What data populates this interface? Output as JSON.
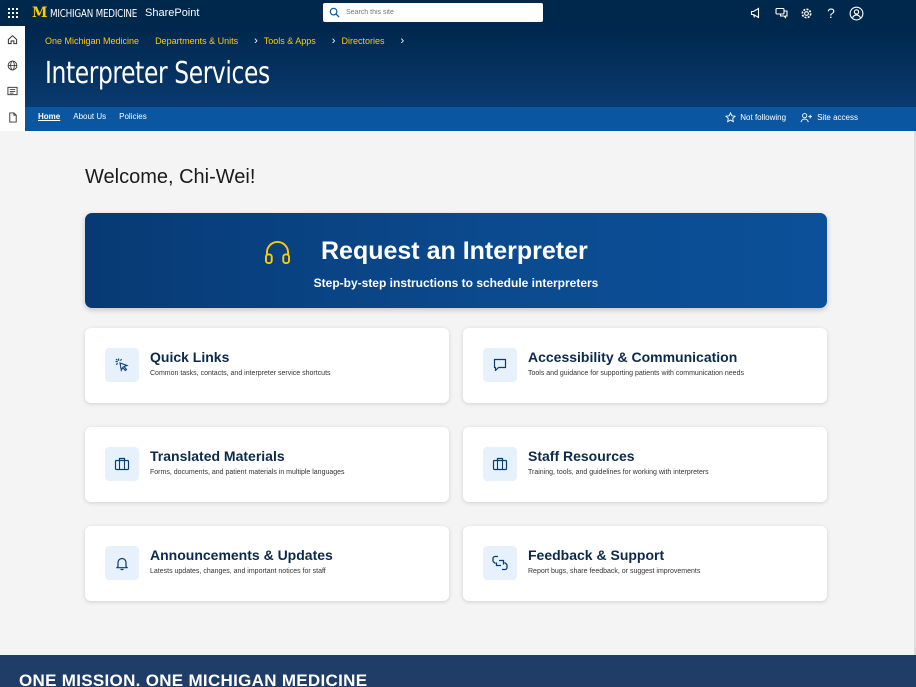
{
  "suite": {
    "logo_mark": "M",
    "logo_text": "MICHIGAN MEDICINE",
    "app_name": "SharePoint",
    "search_placeholder": "Search this site",
    "icons": [
      "megaphone-icon",
      "chat-icon",
      "gear-icon",
      "help-icon",
      "account-icon"
    ],
    "help_glyph": "?"
  },
  "rail": {
    "icons": [
      "home-icon",
      "globe-icon",
      "news-icon",
      "file-icon"
    ]
  },
  "header": {
    "breadcrumb": [
      "One Michigan Medicine",
      "Departments & Units",
      "Tools & Apps",
      "Directories"
    ],
    "title": "Interpreter Services"
  },
  "nav": {
    "links": [
      "Home",
      "About Us",
      "Policies"
    ],
    "follow_label": "Not following",
    "access_label": "Site access"
  },
  "main": {
    "welcome": "Welcome, Chi-Wei!",
    "hero": {
      "title": "Request an Interpreter",
      "subtitle": "Step-by-step instructions to schedule interpreters"
    },
    "cards": [
      {
        "title": "Quick Links",
        "desc": "Common tasks, contacts, and interpreter service shortcuts",
        "icon": "cursor-click-icon"
      },
      {
        "title": "Accessibility & Communication",
        "desc": "Tools and guidance for supporting patients with communication needs",
        "icon": "chat-bubble-icon"
      },
      {
        "title": "Translated Materials",
        "desc": "Forms, documents, and patient materials in multiple languages",
        "icon": "briefcase-icon"
      },
      {
        "title": "Staff Resources",
        "desc": "Training, tools, and guidelines for working with interpreters",
        "icon": "briefcase-icon"
      },
      {
        "title": "Announcements & Updates",
        "desc": "Latests updates, changes, and important notices for staff",
        "icon": "bell-icon"
      },
      {
        "title": "Feedback & Support",
        "desc": "Report bugs, share feedback, or suggest improvements",
        "icon": "feedback-icon"
      }
    ]
  },
  "footer": {
    "text": "ONE MISSION. ONE MICHIGAN MEDICINE"
  },
  "colors": {
    "navy": "#00274c",
    "maize": "#ffcb05",
    "nav_blue": "#0a56a0",
    "hero_blue": "#0b4a8e",
    "icon_tile": "#e6f1fb"
  }
}
